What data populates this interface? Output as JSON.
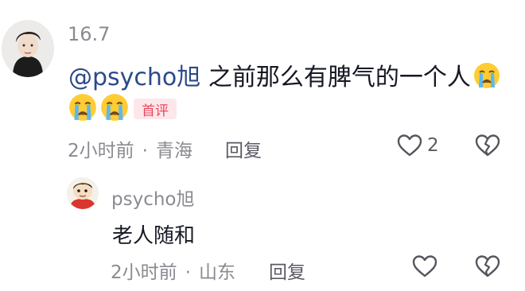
{
  "main_comment": {
    "username": "16.7",
    "mention": "@psycho旭",
    "text": " 之前那么有脾气的一个人",
    "badge": "首评",
    "time": "2小时前",
    "location": "青海",
    "reply_label": "回复",
    "like_count": "2"
  },
  "reply_comment": {
    "username": "psycho旭",
    "text": "老人随和",
    "time": "2小时前",
    "location": "山东",
    "reply_label": "回复"
  },
  "icons": {
    "emoji": "crying-face-icon",
    "like": "heart-icon",
    "dislike": "broken-heart-icon"
  },
  "colors": {
    "mention": "#2b4a8a",
    "badge_bg": "#fde7ea",
    "badge_text": "#e8475e",
    "meta": "#8a8b91"
  }
}
